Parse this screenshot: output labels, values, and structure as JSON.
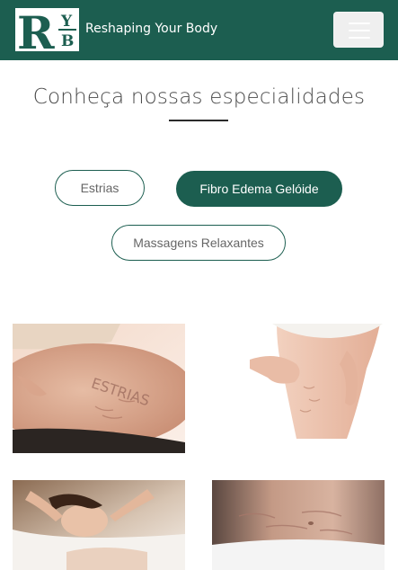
{
  "brand": {
    "logo_letters": [
      "R",
      "Y",
      "B"
    ],
    "name": "Reshaping Your Body"
  },
  "navbar": {
    "menu_icon": "hamburger-menu-icon"
  },
  "section": {
    "title": "Conheça nossas especialidades"
  },
  "filters": [
    {
      "label": "Estrias",
      "active": false
    },
    {
      "label": "Fibro Edema Gelóide",
      "active": true
    },
    {
      "label": "Massagens Relaxantes",
      "active": false
    }
  ],
  "gallery": {
    "card1": {
      "caption": "ESTRIAS"
    }
  },
  "colors": {
    "brand_green": "#1c5e50",
    "white": "#ffffff",
    "text_gray": "#666666"
  }
}
